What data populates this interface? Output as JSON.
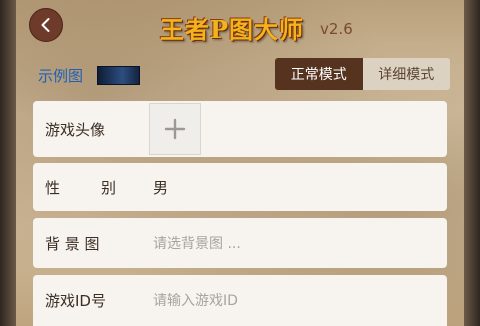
{
  "header": {
    "app_title": "王者P图大师",
    "version": "v2.6",
    "back_icon": "chevron-left-icon"
  },
  "example": {
    "link_label": "示例图"
  },
  "mode_switch": {
    "normal_label": "正常模式",
    "detailed_label": "详细模式",
    "active": "normal"
  },
  "form": {
    "avatar_label": "游戏头像",
    "avatar_add_icon": "plus-icon",
    "gender_label_char1": "性",
    "gender_label_char2": "别",
    "gender_value": "男",
    "background_label": "背 景 图",
    "background_placeholder": "请选背景图 ...",
    "game_id_label": "游戏ID号",
    "game_id_placeholder": "请输入游戏ID"
  },
  "colors": {
    "accent_brown": "#55331f",
    "title_gold": "#f2b31c",
    "link_blue": "#1e60b8"
  }
}
